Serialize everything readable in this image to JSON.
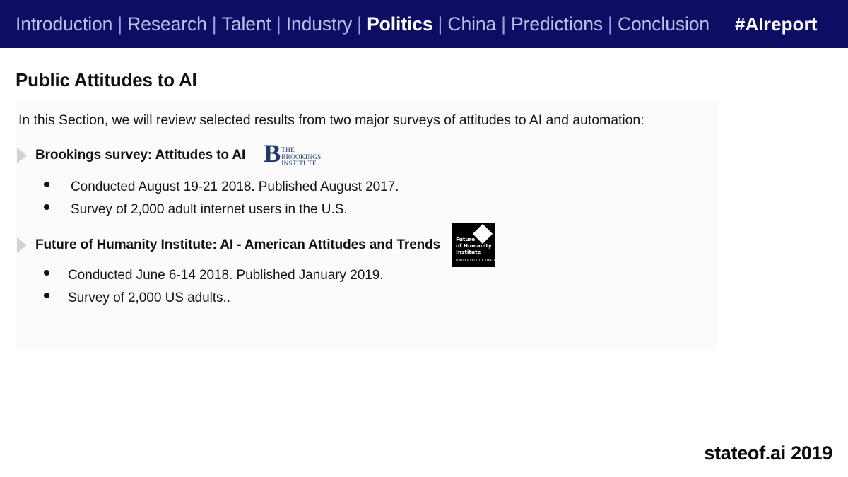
{
  "navbar": {
    "items": [
      {
        "label": "Introduction",
        "active": false
      },
      {
        "label": "Research",
        "active": false
      },
      {
        "label": "Talent",
        "active": false
      },
      {
        "label": "Industry",
        "active": false
      },
      {
        "label": "Politics",
        "active": true
      },
      {
        "label": "China",
        "active": false
      },
      {
        "label": "Predictions",
        "active": false
      },
      {
        "label": "Conclusion",
        "active": false
      }
    ],
    "separator": "|",
    "hashtag": "#AIreport",
    "background_color": "#0d0d63",
    "link_color": "#bcc0e8",
    "active_color": "#ffffff"
  },
  "slide": {
    "title": "Public Attitudes to AI",
    "intro": "In this Section, we will review selected results from two major surveys of attitudes to AI and automation:",
    "surveys": [
      {
        "heading": "Brookings survey: Attitudes to AI",
        "logo": "brookings-logo",
        "logo_text": {
          "initial": "B",
          "line1": "THE",
          "line2": "BROOKINGS",
          "line3": "INSTITUTE"
        },
        "bullets": [
          "Conducted August 19-21 2018. Published August 2017.",
          "Survey of 2,000 adult internet users in the U.S."
        ]
      },
      {
        "heading": "Future of Humanity Institute: AI - American Attitudes and Trends",
        "logo": "fhi-logo",
        "logo_text": {
          "line1": "Future",
          "line2": "of Humanity",
          "line3": "Institute",
          "sub": "UNIVERSITY OF OXFORD"
        },
        "bullets": [
          "Conducted June 6-14 2018. Published January 2019.",
          "Survey of 2,000 US adults.."
        ]
      }
    ]
  },
  "footer": {
    "label": "stateof.ai 2019"
  }
}
